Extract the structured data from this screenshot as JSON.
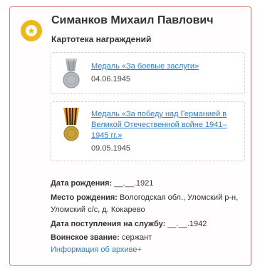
{
  "person": {
    "name": "Симанков Михаил Павлович",
    "section_title": "Картотека награждений"
  },
  "awards": [
    {
      "name": "Медаль «За боевые заслуги»",
      "date": "04.06.1945",
      "icon": "silver-medal-icon"
    },
    {
      "name": "Медаль «За победу над Германией в Великой Отечественной войне 1941–1945 гг.»",
      "date": "09.05.1945",
      "icon": "st-george-ribbon-medal-icon"
    }
  ],
  "details": {
    "birth_date_label": "Дата рождения:",
    "birth_date_value": "__.__.1921",
    "birth_place_label": "Место рождения:",
    "birth_place_value": "Вологодская обл., Уломский р-н, Уломский с/с, д. Кокарево",
    "service_date_label": "Дата поступления на службу:",
    "service_date_value": "__.__.1942",
    "rank_label": "Воинское звание:",
    "rank_value": "сержант"
  },
  "archive_link": "Информация об архиве+",
  "colors": {
    "border": "#e07a7a",
    "badge": "#f0b51f",
    "link": "#2a7fd4"
  }
}
